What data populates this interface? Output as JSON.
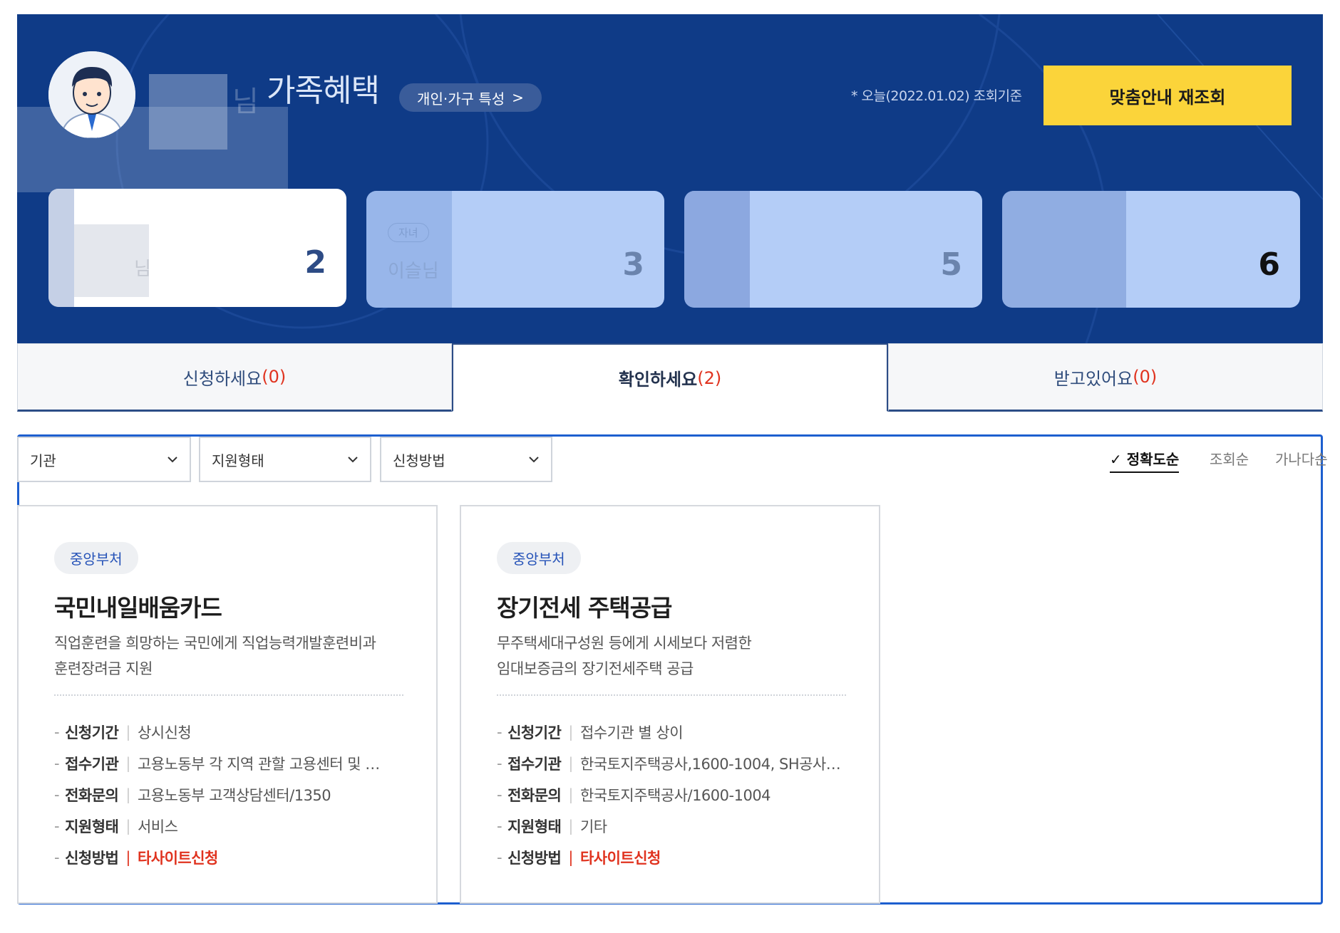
{
  "hero": {
    "title_suffix": "님",
    "title": "가족혜택",
    "characteristics_label": "개인·가구 특성",
    "characteristics_arrow": ">",
    "date_note": "* 오늘(2022.01.02) 조회기준",
    "refresh_label": "맞춤안내 재조회",
    "members": [
      {
        "badge": "",
        "name": "님",
        "count": "2"
      },
      {
        "badge": "자녀",
        "name": "이슬님",
        "count": "3"
      },
      {
        "badge": "",
        "name": "",
        "count": "5"
      },
      {
        "badge": "",
        "name": "",
        "count": "6"
      }
    ]
  },
  "tabs": [
    {
      "label": "신청하세요",
      "count": "(0)"
    },
    {
      "label": "확인하세요",
      "count": "(2)"
    },
    {
      "label": "받고있어요",
      "count": "(0)"
    }
  ],
  "filters": {
    "agency": "기관",
    "support_type": "지원형태",
    "apply_method": "신청방법"
  },
  "sort": {
    "check": "✓",
    "accuracy": "정확도순",
    "views": "조회순",
    "alphabetical": "가나다순"
  },
  "benefits": [
    {
      "category": "중앙부처",
      "title": "국민내일배움카드",
      "desc_line1": "직업훈련을 희망하는 국민에게 직업능력개발훈련비과",
      "desc_line2": "훈련장려금 지원",
      "rows": [
        {
          "key": "신청기간",
          "value": "상시신청"
        },
        {
          "key": "접수기관",
          "value": "고용노동부 각 지역 관할 고용센터 및 …"
        },
        {
          "key": "전화문의",
          "value": "고용노동부 고객상담센터/1350"
        },
        {
          "key": "지원형태",
          "value": "서비스"
        },
        {
          "key": "신청방법",
          "value": "타사이트신청"
        }
      ]
    },
    {
      "category": "중앙부처",
      "title": "장기전세 주택공급",
      "desc_line1": "무주택세대구성원 등에게 시세보다 저렴한",
      "desc_line2": "임대보증금의 장기전세주택 공급",
      "rows": [
        {
          "key": "신청기간",
          "value": "접수기관 별 상이"
        },
        {
          "key": "접수기관",
          "value": "한국토지주택공사,1600-1004, SH공사…"
        },
        {
          "key": "전화문의",
          "value": "한국토지주택공사/1600-1004"
        },
        {
          "key": "지원형태",
          "value": "기타"
        },
        {
          "key": "신청방법",
          "value": "타사이트신청"
        }
      ]
    }
  ],
  "colors": {
    "hero_bg": "#0f3b87",
    "accent_yellow": "#fbd43a",
    "count_red": "#e0331f",
    "panel_border": "#1d5fcf"
  },
  "icons": {
    "avatar": "user-avatar-icon",
    "dropdown": "chevron-down-icon",
    "check": "check-icon"
  }
}
